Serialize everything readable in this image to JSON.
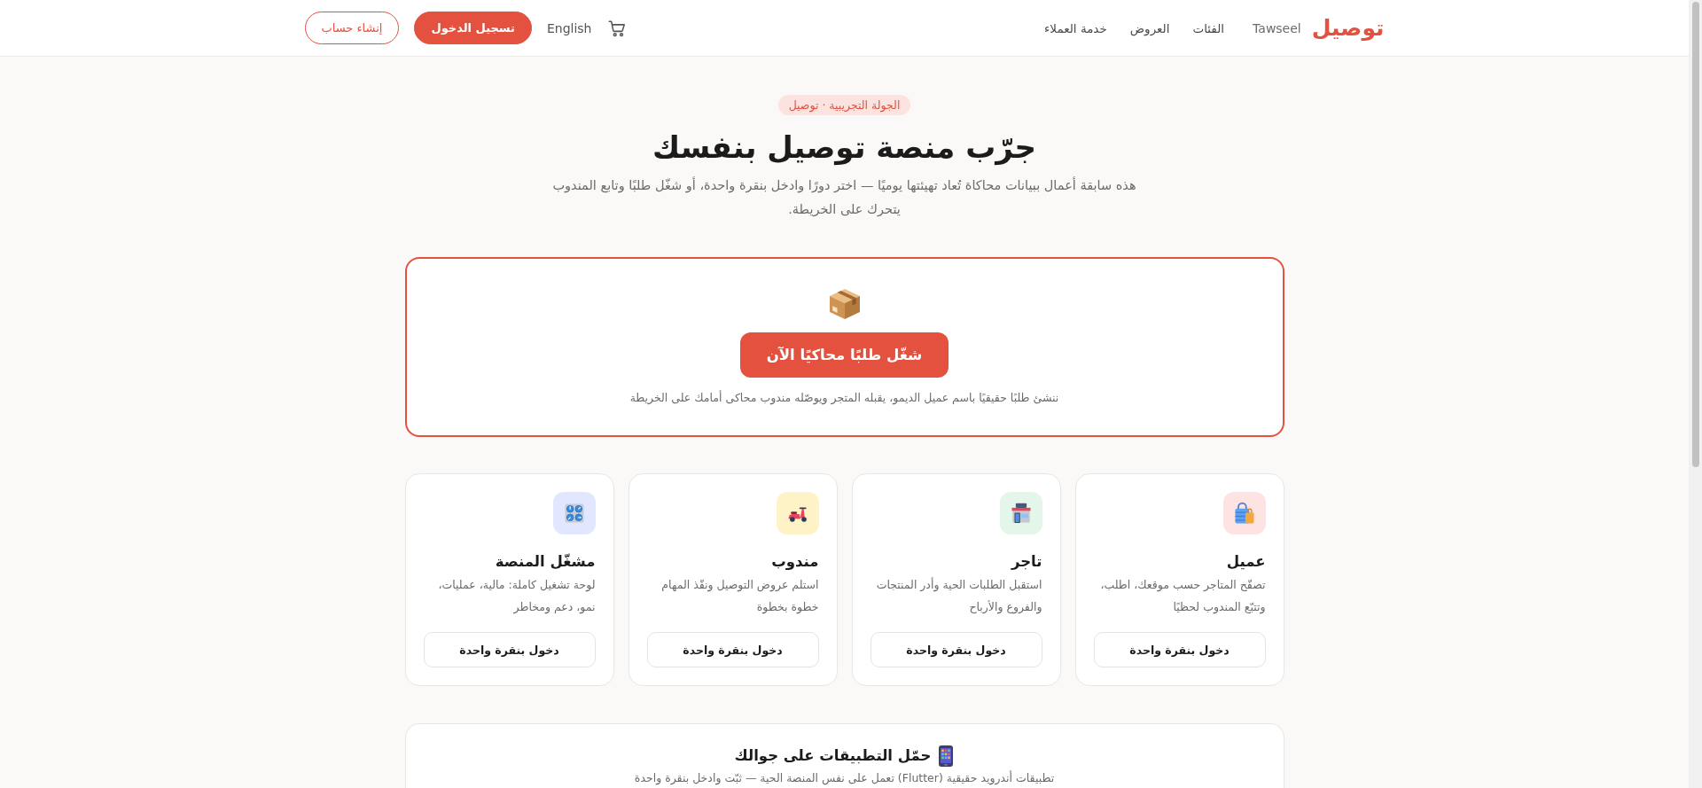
{
  "header": {
    "logo": "توصيل",
    "logo_subtitle": "Tawseel",
    "nav": [
      "الفئات",
      "العروض",
      "خدمة العملاء"
    ],
    "language": "English",
    "login": "تسجيل الدخول",
    "signup": "إنشاء حساب"
  },
  "hero": {
    "badge": "الجولة التجريبية · توصيل",
    "title": "جرّب منصة توصيل بنفسك",
    "subtitle": "هذه سابقة أعمال ببيانات محاكاة تُعاد تهيئتها يوميًا — اختر دورًا وادخل بنقرة واحدة، أو شغّل طلبًا وتابع المندوب يتحرك على الخريطة."
  },
  "demo": {
    "button": "شغّل طلبًا محاكيًا الآن",
    "caption": "ننشئ طلبًا حقيقيًا باسم عميل الديمو، يقبله المتجر ويوصّله مندوب محاكى أمامك على الخريطة"
  },
  "roles": [
    {
      "title": "عميل",
      "description": "تصفّح المتاجر حسب موقعك، اطلب، وتتبّع المندوب لحظيًا",
      "button": "دخول بنقرة واحدة",
      "color": "#fde4e2"
    },
    {
      "title": "تاجر",
      "description": "استقبل الطلبات الحية وأدر المنتجات والفروع والأرباح",
      "button": "دخول بنقرة واحدة",
      "color": "#e4f5ea"
    },
    {
      "title": "مندوب",
      "description": "استلم عروض التوصيل ونفّذ المهام خطوة بخطوة",
      "button": "دخول بنقرة واحدة",
      "color": "#fef3c7"
    },
    {
      "title": "مشغّل المنصة",
      "description": "لوحة تشغيل كاملة: مالية، عمليات، نمو، دعم ومخاطر",
      "button": "دخول بنقرة واحدة",
      "color": "#e0e7ff"
    }
  ],
  "apps": {
    "title": "حمّل التطبيقات على جوالك",
    "subtitle": "تطبيقات أندرويد حقيقية (Flutter) تعمل على نفس المنصة الحية — ثبّت وادخل بنقرة واحدة"
  }
}
